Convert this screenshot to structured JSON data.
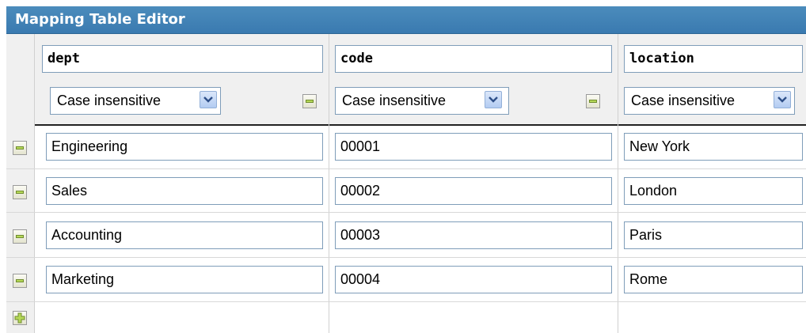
{
  "title": "Mapping Table Editor",
  "columns": [
    {
      "name": "dept",
      "match": "Case insensitive"
    },
    {
      "name": "code",
      "match": "Case insensitive"
    },
    {
      "name": "location",
      "match": "Case insensitive"
    }
  ],
  "rows": [
    [
      "Engineering",
      "00001",
      "New York"
    ],
    [
      "Sales",
      "00002",
      "London"
    ],
    [
      "Accounting",
      "00003",
      "Paris"
    ],
    [
      "Marketing",
      "00004",
      "Rome"
    ]
  ],
  "colors": {
    "title_bar": "#3a7ab0",
    "title_text": "#ffffff",
    "field_border": "#7f9db9"
  }
}
